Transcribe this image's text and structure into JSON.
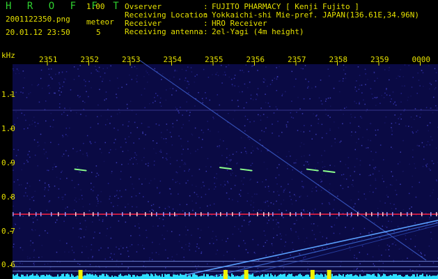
{
  "header": {
    "title": "H R O F F T",
    "version": "1.00",
    "filename": "2001122350.png",
    "meteor_label": "meteor",
    "datetime": "20.01.12 23:50",
    "meteor_count": "5"
  },
  "info": [
    {
      "key": "Ovserver",
      "value": "FUJITO PHARMACY [ Kenji Fujito ]"
    },
    {
      "key": "Receiving Location",
      "value": "Yokkaichi-shi Mie-pref. JAPAN(136.61E,34.96N)"
    },
    {
      "key": "Receiver",
      "value": "HRO Receiver"
    },
    {
      "key": "Receiving antenna",
      "value": "2el-Yagi (4m height)"
    }
  ],
  "chart_data": {
    "type": "heatmap",
    "ylabel": "kHz",
    "x_ticks": [
      "2351",
      "2352",
      "2353",
      "2354",
      "2355",
      "2356",
      "2357",
      "2358",
      "2359",
      "0000"
    ],
    "y_ticks": [
      "1.1",
      "1.0",
      "0.9",
      "0.8",
      "0.7",
      "0.6"
    ],
    "ylim": [
      0.56,
      1.19
    ],
    "reference_line_khz": 0.75,
    "meteor_echoes": [
      {
        "time": "2351.8",
        "khz": 0.88
      },
      {
        "time": "2355.3",
        "khz": 0.885
      },
      {
        "time": "2355.8",
        "khz": 0.88
      },
      {
        "time": "2357.4",
        "khz": 0.88
      },
      {
        "time": "2357.8",
        "khz": 0.875
      }
    ],
    "colors": {
      "background": "#0a0a44",
      "reference_line": "#ff2040",
      "echo": "#8cff8c",
      "grid": "#6a7fd0",
      "text": "#e5e000",
      "title": "#2fd12f"
    }
  }
}
